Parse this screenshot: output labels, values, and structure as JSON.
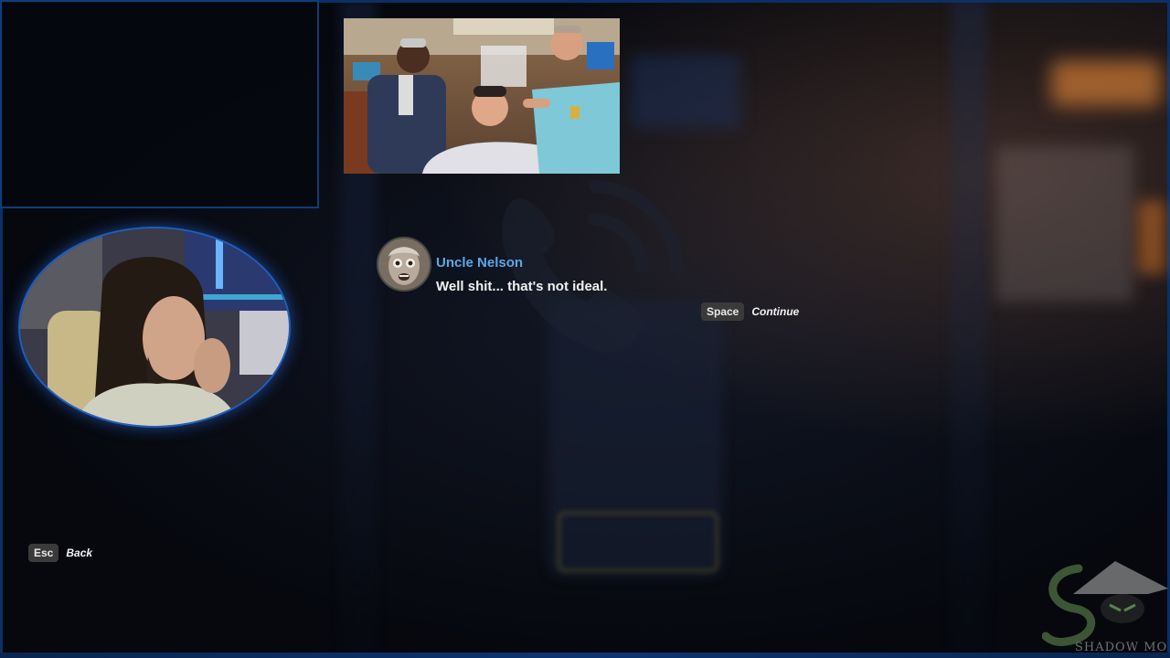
{
  "dialog": {
    "speaker": "Uncle Nelson",
    "line": "Well shit... that's not ideal."
  },
  "hints": {
    "continue_key": "Space",
    "continue_label": "Continue",
    "back_key": "Esc",
    "back_label": "Back"
  },
  "watermark": {
    "logo_text": "SHADOW MONK"
  },
  "colors": {
    "accent_blue": "#5aa8e8",
    "frame_blue": "#0f3d7a",
    "key_bg": "#3a3a3a"
  },
  "icons": {
    "phone_watermark": "phone-icon"
  }
}
